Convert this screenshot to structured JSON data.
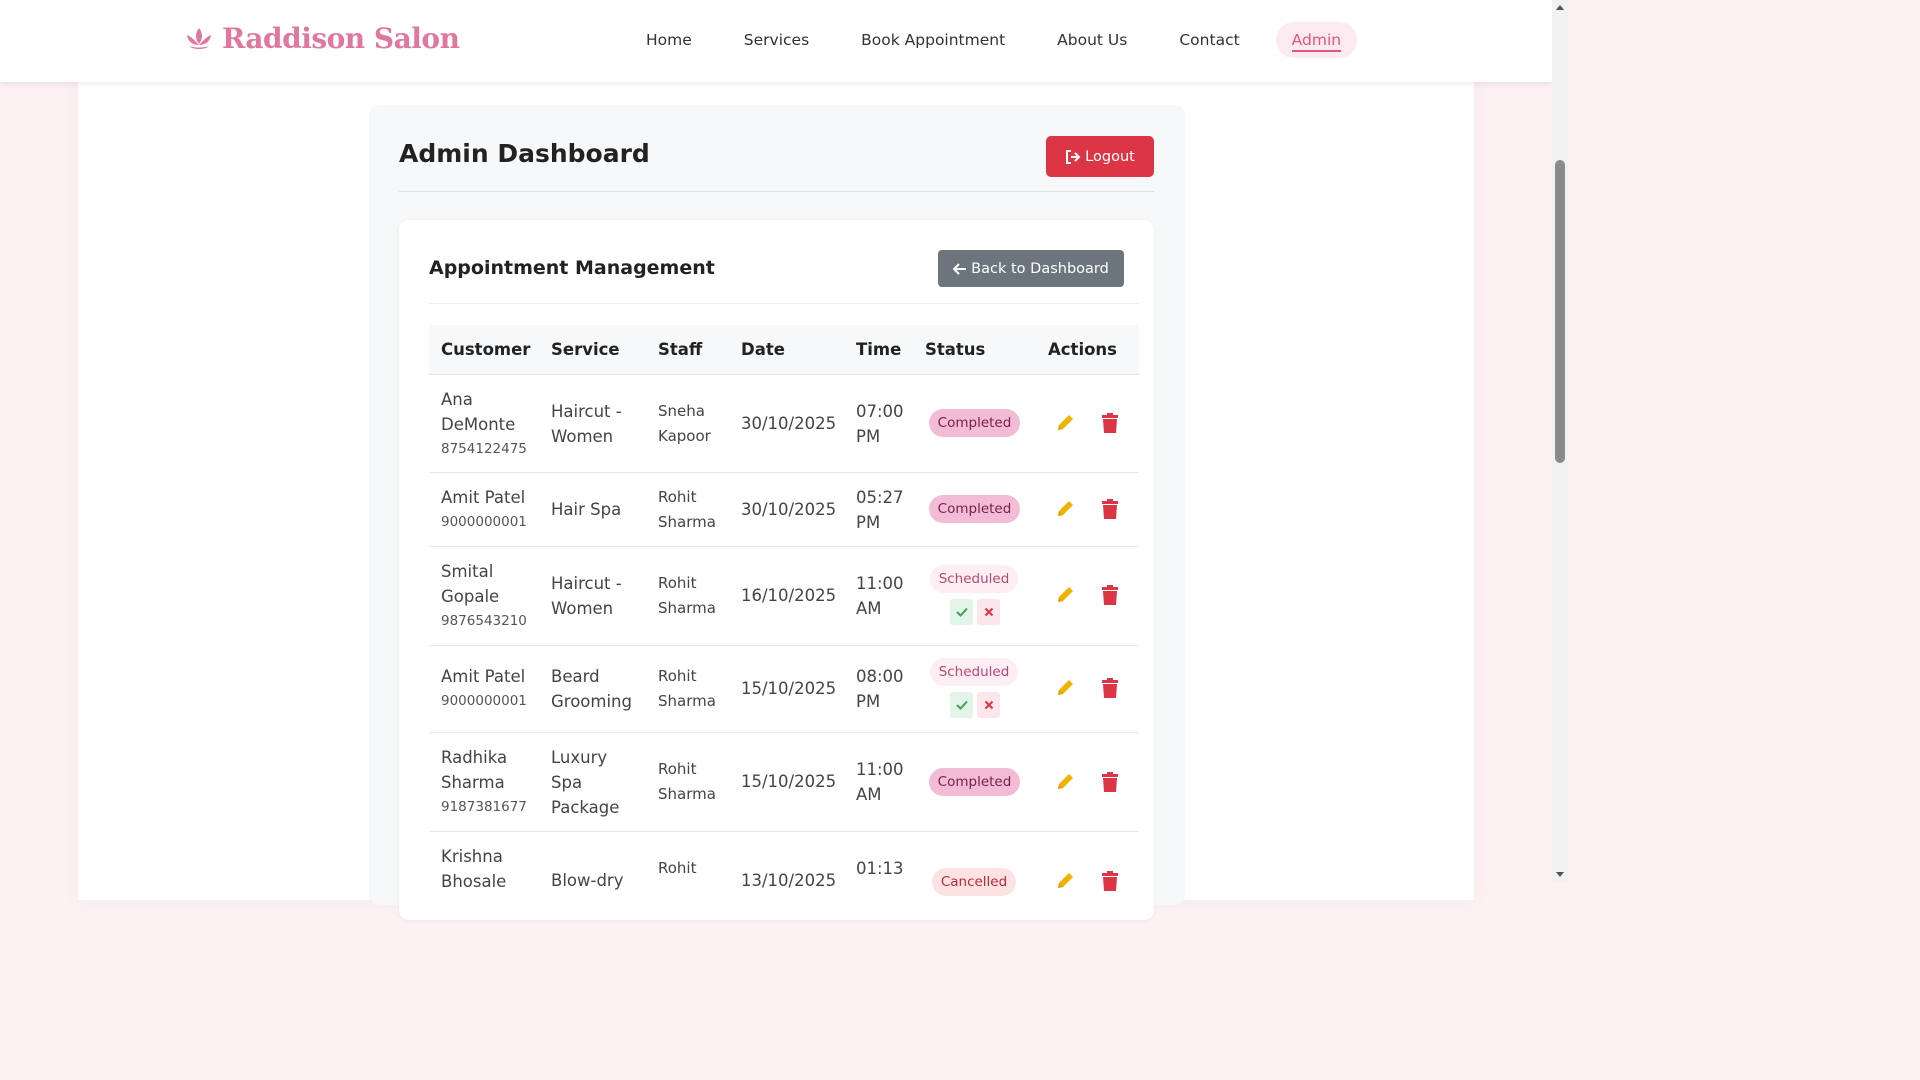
{
  "brand": {
    "name": "Raddison Salon",
    "logo_icon": "lotus-icon",
    "color": "#e0789e"
  },
  "nav": {
    "items": [
      {
        "label": "Home"
      },
      {
        "label": "Services"
      },
      {
        "label": "Book Appointment"
      },
      {
        "label": "About Us"
      },
      {
        "label": "Contact"
      },
      {
        "label": "Admin",
        "active": true
      }
    ]
  },
  "dashboard": {
    "title": "Admin Dashboard",
    "logout_label": "Logout",
    "logout_icon": "logout-icon"
  },
  "appointments": {
    "title": "Appointment Management",
    "back_label": "Back to Dashboard",
    "back_icon": "arrow-left-icon",
    "columns": [
      "Customer",
      "Service",
      "Staff",
      "Date",
      "Time",
      "Status",
      "Actions"
    ],
    "rows": [
      {
        "customer": "Ana DeMonte",
        "phone": "8754122475",
        "service": "Haircut - Women",
        "staff": "Sneha Kapoor",
        "date": "30/10/2025",
        "time": "07:00 PM",
        "status": "Completed"
      },
      {
        "customer": "Amit Patel",
        "phone": "9000000001",
        "service": "Hair Spa",
        "staff": "Rohit Sharma",
        "date": "30/10/2025",
        "time": "05:27 PM",
        "status": "Completed"
      },
      {
        "customer": "Smital Gopale",
        "phone": "9876543210",
        "service": "Haircut - Women",
        "staff": "Rohit Sharma",
        "date": "16/10/2025",
        "time": "11:00 AM",
        "status": "Scheduled"
      },
      {
        "customer": "Amit Patel",
        "phone": "9000000001",
        "service": "Beard Grooming",
        "staff": "Rohit Sharma",
        "date": "15/10/2025",
        "time": "08:00 PM",
        "status": "Scheduled"
      },
      {
        "customer": "Radhika Sharma",
        "phone": "9187381677",
        "service": "Luxury Spa Package",
        "staff": "Rohit Sharma",
        "date": "15/10/2025",
        "time": "11:00 AM",
        "status": "Completed"
      },
      {
        "customer": "Krishna Bhosale",
        "phone": "",
        "service": "Blow-dry",
        "staff": "Rohit",
        "date": "13/10/2025",
        "time": "01:13",
        "status": "Cancelled"
      }
    ]
  },
  "colors": {
    "accent": "#e0567e",
    "danger": "#dc3545",
    "secondary": "#6c757d",
    "edit": "#f0b400"
  }
}
